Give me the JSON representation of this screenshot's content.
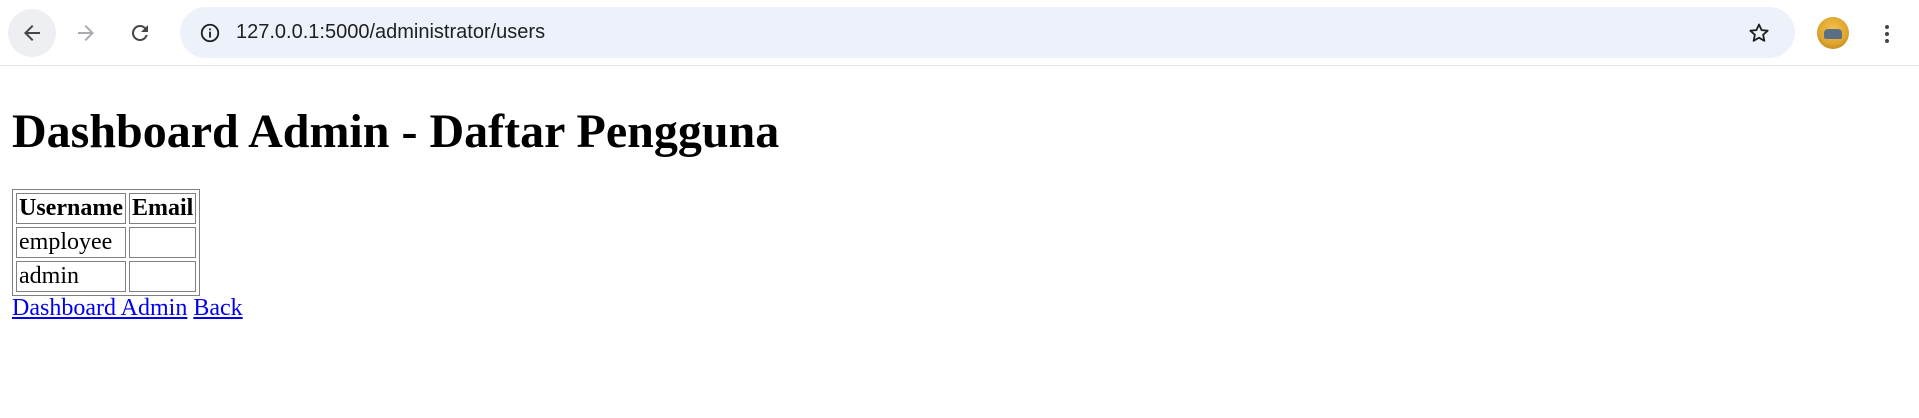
{
  "browser": {
    "url": "127.0.0.1:5000/administrator/users",
    "icons": {
      "back": "arrow-left-icon",
      "forward": "arrow-right-icon",
      "reload": "reload-icon",
      "site_info": "info-icon",
      "bookmark": "star-icon",
      "menu": "kebab-menu-icon"
    }
  },
  "page": {
    "title": "Dashboard Admin - Daftar Pengguna",
    "table": {
      "headers": [
        "Username",
        "Email"
      ],
      "rows": [
        [
          "employee",
          ""
        ],
        [
          "admin",
          ""
        ]
      ]
    },
    "links": {
      "dashboard": "Dashboard Admin",
      "back": "Back"
    }
  },
  "colors": {
    "link": "#0000ee",
    "omnibox_bg": "#edf2fa"
  }
}
